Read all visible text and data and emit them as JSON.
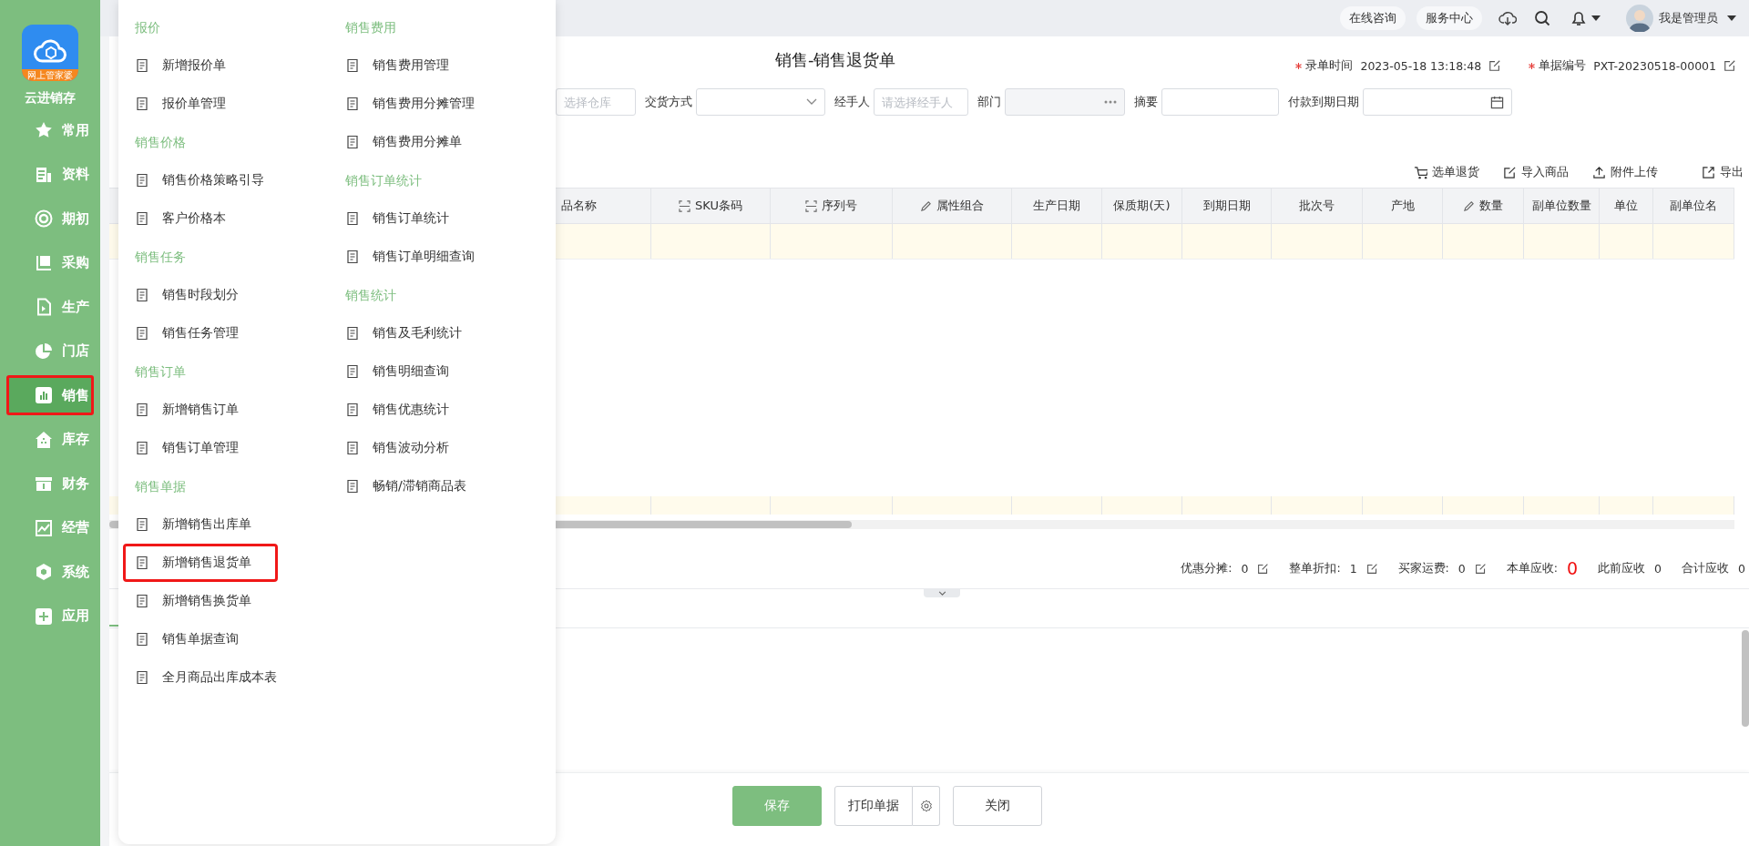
{
  "sidebar": {
    "logo_badge": "网上管家婆",
    "app_name": "云进销存",
    "items": [
      {
        "label": "常用",
        "selected": false,
        "highlighted": false
      },
      {
        "label": "资料",
        "selected": false,
        "highlighted": false
      },
      {
        "label": "期初",
        "selected": false,
        "highlighted": false
      },
      {
        "label": "采购",
        "selected": false,
        "highlighted": false
      },
      {
        "label": "生产",
        "selected": false,
        "highlighted": false
      },
      {
        "label": "门店",
        "selected": false,
        "highlighted": false
      },
      {
        "label": "销售",
        "selected": true,
        "highlighted": true
      },
      {
        "label": "库存",
        "selected": false,
        "highlighted": false
      },
      {
        "label": "财务",
        "selected": false,
        "highlighted": false
      },
      {
        "label": "经营",
        "selected": false,
        "highlighted": false
      },
      {
        "label": "系统",
        "selected": false,
        "highlighted": false
      },
      {
        "label": "应用",
        "selected": false,
        "highlighted": false
      }
    ]
  },
  "topbar": {
    "buttons": [
      "在线咨询",
      "服务中心"
    ],
    "user": "我是管理员"
  },
  "header": {
    "title": "销售-销售退货单",
    "meta": [
      {
        "label": "录单时间",
        "value": "2023-05-18 13:18:48",
        "required": true
      },
      {
        "label": "单据编号",
        "value": "PXT-20230518-00001",
        "required": true
      }
    ]
  },
  "fields_row": {
    "fields": [
      {
        "kind": "input",
        "placeholder": "选择仓库"
      },
      {
        "kind": "select",
        "label": "交货方式"
      },
      {
        "kind": "input",
        "label": "经手人",
        "placeholder": "请选择经手人"
      },
      {
        "kind": "disabled",
        "label": "部门"
      },
      {
        "kind": "input",
        "label": "摘要"
      },
      {
        "kind": "date",
        "label": "付款到期日期"
      }
    ]
  },
  "toolbar": [
    {
      "label": "选单退货"
    },
    {
      "label": "导入商品"
    },
    {
      "label": "附件上传"
    },
    {
      "label": "导出"
    }
  ],
  "table": {
    "columns": [
      {
        "label": "品名称",
        "kind": "plain"
      },
      {
        "label": "SKU条码",
        "kind": "scan"
      },
      {
        "label": "序列号",
        "kind": "scan"
      },
      {
        "label": "属性组合",
        "kind": "editable"
      },
      {
        "label": "生产日期",
        "kind": "plain"
      },
      {
        "label": "保质期(天)",
        "kind": "plain"
      },
      {
        "label": "到期日期",
        "kind": "plain"
      },
      {
        "label": "批次号",
        "kind": "plain"
      },
      {
        "label": "产地",
        "kind": "plain"
      },
      {
        "label": "数量",
        "kind": "editable"
      },
      {
        "label": "副单位数量",
        "kind": "plain"
      },
      {
        "label": "单位",
        "kind": "plain"
      },
      {
        "label": "副单位名",
        "kind": "plain"
      }
    ]
  },
  "totals": {
    "items": [
      {
        "label": "优惠分摊:",
        "value": "0",
        "kind": "editable"
      },
      {
        "label": "整单折扣:",
        "value": "1",
        "kind": "editable"
      },
      {
        "label": "买家运费:",
        "value": "0",
        "kind": "editable"
      },
      {
        "label": "本单应收:",
        "value": "0",
        "kind": "emphasis"
      },
      {
        "label": "此前应收",
        "value": "0",
        "kind": "plain"
      },
      {
        "label": "合计应收",
        "value": "0",
        "kind": "plain"
      }
    ]
  },
  "remarks": {
    "tab": {
      "selected": true
    }
  },
  "footer": {
    "buttons": [
      {
        "label": "保存",
        "kind": "primary"
      },
      {
        "label": "打印单据",
        "kind": "split"
      },
      {
        "label": "关闭",
        "kind": "default"
      }
    ]
  },
  "menu": {
    "columns": [
      [
        {
          "kind": "heading",
          "label": "报价"
        },
        {
          "kind": "item",
          "label": "新增报价单",
          "highlighted": false
        },
        {
          "kind": "item",
          "label": "报价单管理",
          "highlighted": false
        },
        {
          "kind": "heading",
          "label": "销售价格"
        },
        {
          "kind": "item",
          "label": "销售价格策略引导",
          "highlighted": false
        },
        {
          "kind": "item",
          "label": "客户价格本",
          "highlighted": false
        },
        {
          "kind": "heading",
          "label": "销售任务"
        },
        {
          "kind": "item",
          "label": "销售时段划分",
          "highlighted": false
        },
        {
          "kind": "item",
          "label": "销售任务管理",
          "highlighted": false
        },
        {
          "kind": "heading",
          "label": "销售订单"
        },
        {
          "kind": "item",
          "label": "新增销售订单",
          "highlighted": false
        },
        {
          "kind": "item",
          "label": "销售订单管理",
          "highlighted": false
        },
        {
          "kind": "heading",
          "label": "销售单据"
        },
        {
          "kind": "item",
          "label": "新增销售出库单",
          "highlighted": false
        },
        {
          "kind": "item",
          "label": "新增销售退货单",
          "highlighted": true
        },
        {
          "kind": "item",
          "label": "新增销售换货单",
          "highlighted": false
        },
        {
          "kind": "item",
          "label": "销售单据查询",
          "highlighted": false
        },
        {
          "kind": "item",
          "label": "全月商品出库成本表",
          "highlighted": false
        }
      ],
      [
        {
          "kind": "heading",
          "label": "销售费用"
        },
        {
          "kind": "item",
          "label": "销售费用管理",
          "highlighted": false
        },
        {
          "kind": "item",
          "label": "销售费用分摊管理",
          "highlighted": false
        },
        {
          "kind": "item",
          "label": "销售费用分摊单",
          "highlighted": false
        },
        {
          "kind": "heading",
          "label": "销售订单统计"
        },
        {
          "kind": "item",
          "label": "销售订单统计",
          "highlighted": false
        },
        {
          "kind": "item",
          "label": "销售订单明细查询",
          "highlighted": false
        },
        {
          "kind": "heading",
          "label": "销售统计"
        },
        {
          "kind": "item",
          "label": "销售及毛利统计",
          "highlighted": false
        },
        {
          "kind": "item",
          "label": "销售明细查询",
          "highlighted": false
        },
        {
          "kind": "item",
          "label": "销售优惠统计",
          "highlighted": false
        },
        {
          "kind": "item",
          "label": "销售波动分析",
          "highlighted": false
        },
        {
          "kind": "item",
          "label": "畅销/滞销商品表",
          "highlighted": false
        }
      ]
    ]
  }
}
